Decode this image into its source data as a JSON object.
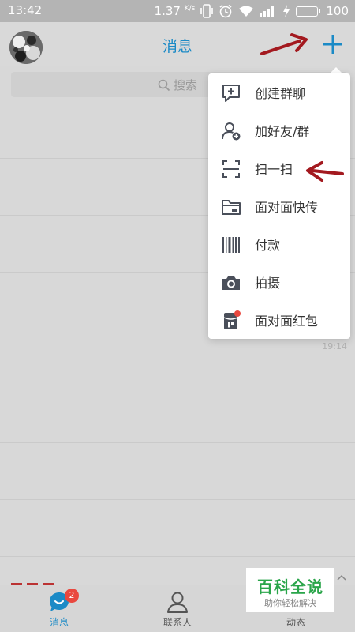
{
  "status_bar": {
    "time": "13:42",
    "net_speed": "1.37",
    "net_unit": "K/s",
    "battery": "100"
  },
  "header": {
    "title": "消息",
    "add_icon": "plus-icon"
  },
  "search": {
    "placeholder": "搜索"
  },
  "popup_menu": {
    "items": [
      {
        "label": "创建群聊",
        "icon": "create-group-chat-icon"
      },
      {
        "label": "加好友/群",
        "icon": "add-friend-icon"
      },
      {
        "label": "扫一扫",
        "icon": "scan-icon"
      },
      {
        "label": "面对面快传",
        "icon": "folder-transfer-icon"
      },
      {
        "label": "付款",
        "icon": "barcode-icon"
      },
      {
        "label": "拍摄",
        "icon": "camera-icon"
      },
      {
        "label": "面对面红包",
        "icon": "red-packet-icon"
      }
    ]
  },
  "list_hint": {
    "time": "19:14"
  },
  "bottom_nav": {
    "tabs": [
      {
        "label": "消息",
        "badge": "2",
        "active": true
      },
      {
        "label": "联系人",
        "active": false
      },
      {
        "label": "动态",
        "active": false
      }
    ]
  },
  "watermark": {
    "main": "百科全说",
    "sub": "助你轻松解决"
  },
  "colors": {
    "accent": "#1b8ac6",
    "annotation_arrow": "#a3191f",
    "badge": "#e9483f",
    "watermark_green": "#2aa54a"
  }
}
